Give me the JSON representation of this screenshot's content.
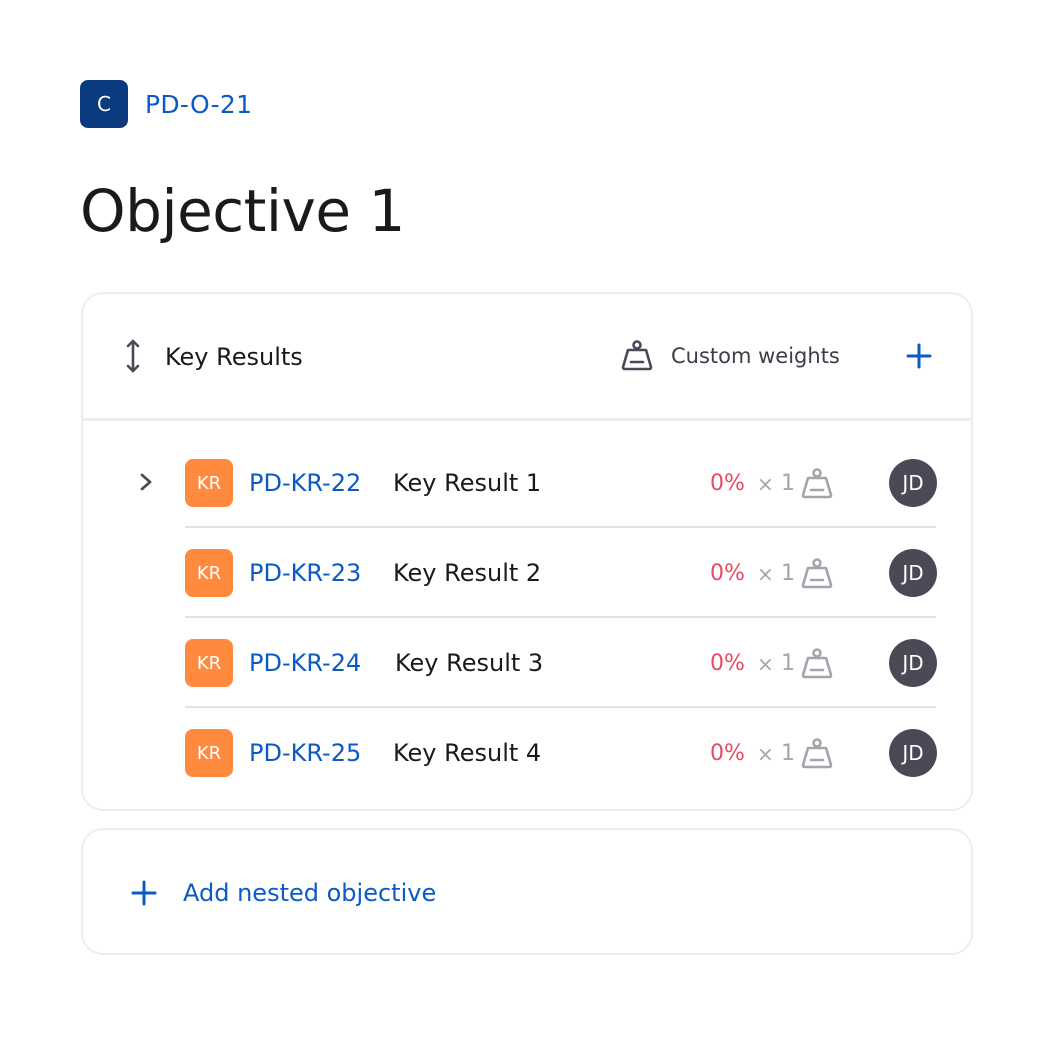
{
  "objective": {
    "badge": "C",
    "key": "PD-O-21",
    "title": "Objective 1"
  },
  "key_results_panel": {
    "title": "Key Results",
    "custom_weights_label": "Custom weights",
    "items": [
      {
        "badge": "KR",
        "key": "PD-KR-22",
        "name": "Key Result 1",
        "progress": "0%",
        "times": "×",
        "weight": "1",
        "assignee": "JD",
        "expandable": true
      },
      {
        "badge": "KR",
        "key": "PD-KR-23",
        "name": "Key Result 2",
        "progress": "0%",
        "times": "×",
        "weight": "1",
        "assignee": "JD",
        "expandable": false
      },
      {
        "badge": "KR",
        "key": "PD-KR-24",
        "name": "Key Result 3",
        "progress": "0%",
        "times": "×",
        "weight": "1",
        "assignee": "JD",
        "expandable": false
      },
      {
        "badge": "KR",
        "key": "PD-KR-25",
        "name": "Key Result 4",
        "progress": "0%",
        "times": "×",
        "weight": "1",
        "assignee": "JD",
        "expandable": false
      }
    ]
  },
  "add_nested": {
    "label": "Add nested objective"
  },
  "colors": {
    "objective_badge": "#0b3a7e",
    "key_result_badge": "#ff8a3d",
    "link_blue": "#0c5ac4",
    "progress_red": "#e84a63",
    "avatar": "#4a4a57"
  },
  "icons": {
    "sort": "sort-arrows-icon",
    "weight": "weight-icon",
    "add": "plus-icon",
    "expand": "chevron-right-icon"
  }
}
